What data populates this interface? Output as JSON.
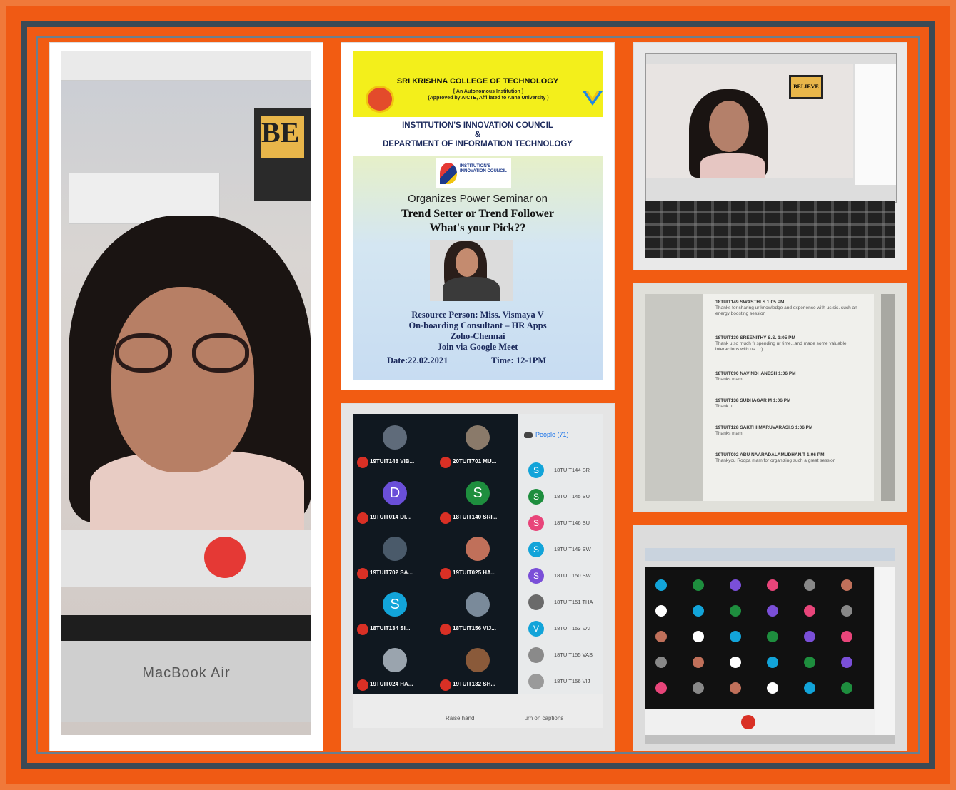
{
  "poster": {
    "college": "SRI KRISHNA COLLEGE OF TECHNOLOGY",
    "college_sub_1": "[ An Autonomous Institution ]",
    "college_sub_2": "(Approved by AICTE, Affiliated to Anna University )",
    "iic_1": "INSTITUTION'S INNOVATION COUNCIL",
    "iic_amp": "&",
    "iic_2": "DEPARTMENT OF INFORMATION TECHNOLOGY",
    "iic_logo_text": "INSTITUTION'S INNOVATION COUNCIL",
    "organizes": "Organizes Power Seminar  on",
    "topic_1": "Trend Setter or Trend Follower",
    "topic_2": "What's your Pick??",
    "resource": "Resource Person: Miss. Vismaya V",
    "role": "On-boarding Consultant – HR Apps",
    "company": "Zoho-Chennai",
    "join": "Join via Google Meet",
    "date": "Date:22.02.2021",
    "time": "Time: 12-1PM"
  },
  "left_photo": {
    "laptop_label": "MacBook Air",
    "sign": "BE"
  },
  "top_right_photo": {
    "sign": "BELIEVE"
  },
  "chat": {
    "messages": [
      {
        "sender": "18TUIT149 SWASTHI.S  1:05 PM",
        "text": "Thanks for sharing ur knowledge and experience with us sis. such an energy boosting session"
      },
      {
        "sender": "18TUIT139 SREENITHY S.S.  1:05 PM",
        "text": "Thank u so much fr spending ur time...and made some valuable interactions with us... :)"
      },
      {
        "sender": "18TUIT090 NAVINDHANESH  1:06 PM",
        "text": "Thanks mam"
      },
      {
        "sender": "19TUIT138 SUDHAGAR M  1:06 PM",
        "text": "Thank u"
      },
      {
        "sender": "19TUIT128 SAKTHI MARUVARASI.S  1:06 PM",
        "text": "Thanks mam"
      },
      {
        "sender": "19TUIT002 ABU NAARADALAMUDHAN.T  1:06 PM",
        "text": "Thankyou Roopa mam for organizing such a great session"
      }
    ]
  },
  "participants": {
    "people_label": "People (71)",
    "tiles": [
      {
        "name": "19TUIT148 VIB...",
        "initial": "",
        "color": "#5f6b7a"
      },
      {
        "name": "20TUIT701 MU...",
        "initial": "",
        "color": "#8a7a6a"
      },
      {
        "name": "19TUIT014 DI...",
        "initial": "D",
        "color": "#6a4fd8"
      },
      {
        "name": "18TUIT140 SRI...",
        "initial": "S",
        "color": "#1e8e3e"
      },
      {
        "name": "19TUIT702 SA...",
        "initial": "",
        "color": "#4a5a6a"
      },
      {
        "name": "19TUIT025 HA...",
        "initial": "",
        "color": "#c0705a"
      },
      {
        "name": "18TUIT134 SI...",
        "initial": "S",
        "color": "#12a4d9"
      },
      {
        "name": "18TUIT156 VIJ...",
        "initial": "",
        "color": "#7a8a9a"
      },
      {
        "name": "19TUIT024 HA...",
        "initial": "",
        "color": "#9aa4ae"
      },
      {
        "name": "19TUIT132 SH...",
        "initial": "",
        "color": "#8a5a3a"
      }
    ],
    "list": [
      {
        "name": "18TUIT144 SR",
        "initial": "S",
        "color": "#12a4d9"
      },
      {
        "name": "18TUIT145 SU",
        "initial": "S",
        "color": "#1e8e3e"
      },
      {
        "name": "18TUIT146 SU",
        "initial": "S",
        "color": "#e8457a"
      },
      {
        "name": "18TUIT149 SW",
        "initial": "S",
        "color": "#12a4d9"
      },
      {
        "name": "18TUIT150 SW",
        "initial": "S",
        "color": "#7a4fd8"
      },
      {
        "name": "18TUIT151 THA",
        "initial": "",
        "color": "#6a6a6a"
      },
      {
        "name": "18TUIT153 VAI",
        "initial": "V",
        "color": "#12a4d9"
      },
      {
        "name": "18TUIT155 VAS",
        "initial": "",
        "color": "#8a8a8a"
      },
      {
        "name": "18TUIT156 VIJ",
        "initial": "",
        "color": "#9a9a9a"
      }
    ],
    "raise_hand": "Raise hand",
    "captions": "Turn on captions"
  }
}
